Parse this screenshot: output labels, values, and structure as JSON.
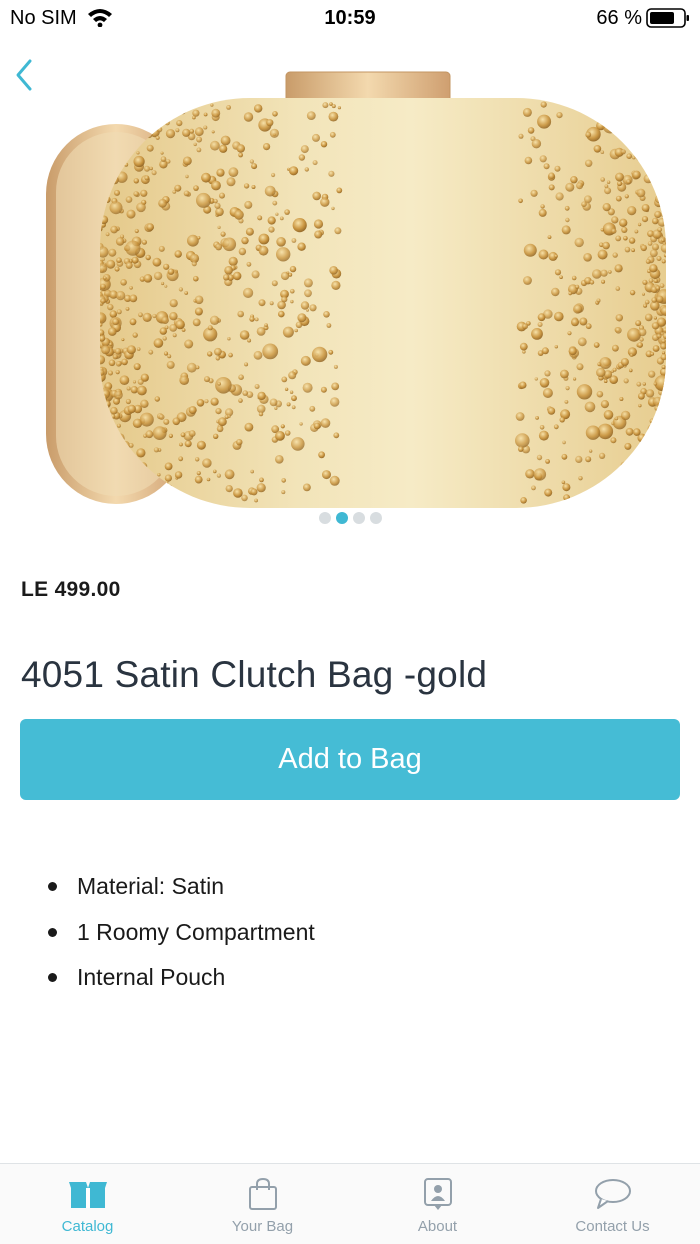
{
  "status_bar": {
    "carrier": "No SIM",
    "time": "10:59",
    "battery": "66 %"
  },
  "product": {
    "price": "LE 499.00",
    "title": "4051 Satin Clutch Bag -gold",
    "add_button_label": "Add to Bag",
    "features": [
      "Material: Satin",
      "1 Roomy Compartment",
      "Internal Pouch"
    ],
    "image_pager": {
      "count": 4,
      "active_index": 1
    }
  },
  "tab_bar": {
    "tabs": [
      {
        "label": "Catalog",
        "icon": "catalog-box-icon",
        "active": true
      },
      {
        "label": "Your Bag",
        "icon": "shopping-bag-icon",
        "active": false
      },
      {
        "label": "About",
        "icon": "contact-card-icon",
        "active": false
      },
      {
        "label": "Contact Us",
        "icon": "chat-bubble-icon",
        "active": false
      }
    ]
  },
  "colors": {
    "accent": "#45bcd5",
    "tab_inactive": "#93a0ab",
    "gold": "#e8cf8e"
  }
}
